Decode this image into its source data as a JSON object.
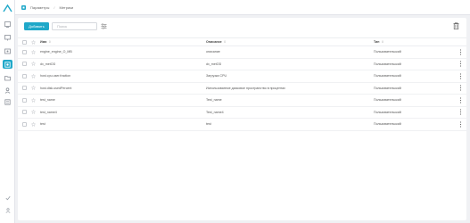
{
  "breadcrumb": [
    "Параметры",
    "Метрики"
  ],
  "toolbar": {
    "create_label": "Добавить",
    "search_placeholder": "Поиск"
  },
  "table": {
    "headers": {
      "name": "Имя",
      "description": "Описание",
      "type": "Тип"
    },
    "rows": [
      {
        "name": "engine_engine_O_MB",
        "description": "описание",
        "type": "Пользовательский"
      },
      {
        "name": "dx_metOD",
        "description": "dx_metOD",
        "type": "Пользовательский"
      },
      {
        "name": "host.cpu.user.fraction",
        "description": "Загрузка CPU",
        "type": "Пользовательский"
      },
      {
        "name": "host.disk.usedPercent",
        "description": "Использованное дисковое пространство в процентах",
        "type": "Пользовательский"
      },
      {
        "name": "test_name",
        "description": "Test_name",
        "type": "Пользовательский"
      },
      {
        "name": "test_name4",
        "description": "Test_name4",
        "type": "Пользовательский"
      },
      {
        "name": "test",
        "description": "test",
        "type": "Пользовательский"
      }
    ]
  },
  "colors": {
    "accent": "#1fa8c9",
    "logo": "#1fa8c9"
  },
  "icons": {
    "logo": "logo-icon",
    "sidebar": [
      "dashboard-icon",
      "monitor-icon",
      "settings-icon",
      "metrics-icon",
      "folder-icon",
      "users-icon",
      "list-icon"
    ],
    "sidebar_bottom": [
      "check-icon",
      "user-icon"
    ]
  }
}
